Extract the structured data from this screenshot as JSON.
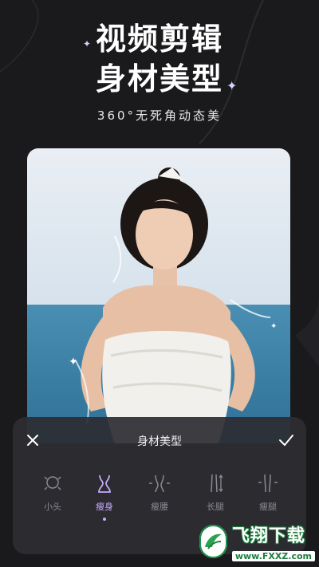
{
  "promo": {
    "line1": "视频剪辑",
    "line2": "身材美型",
    "tagline": "360°无死角动态美"
  },
  "panel": {
    "title": "身材美型",
    "close_icon": "close-icon",
    "confirm_icon": "check-icon"
  },
  "tools": [
    {
      "label": "小头",
      "icon": "small-head-icon",
      "active": false
    },
    {
      "label": "瘦身",
      "icon": "slim-body-icon",
      "active": true
    },
    {
      "label": "瘦腰",
      "icon": "slim-waist-icon",
      "active": false
    },
    {
      "label": "长腿",
      "icon": "long-legs-icon",
      "active": false
    },
    {
      "label": "瘦腿",
      "icon": "slim-legs-icon",
      "active": false
    }
  ],
  "watermark": {
    "brand": "飞翔下载",
    "url": "www.FXXZ.com"
  },
  "colors": {
    "background": "#1a1a1c",
    "accent": "#c7a9ff",
    "panel": "#2d2d32"
  }
}
